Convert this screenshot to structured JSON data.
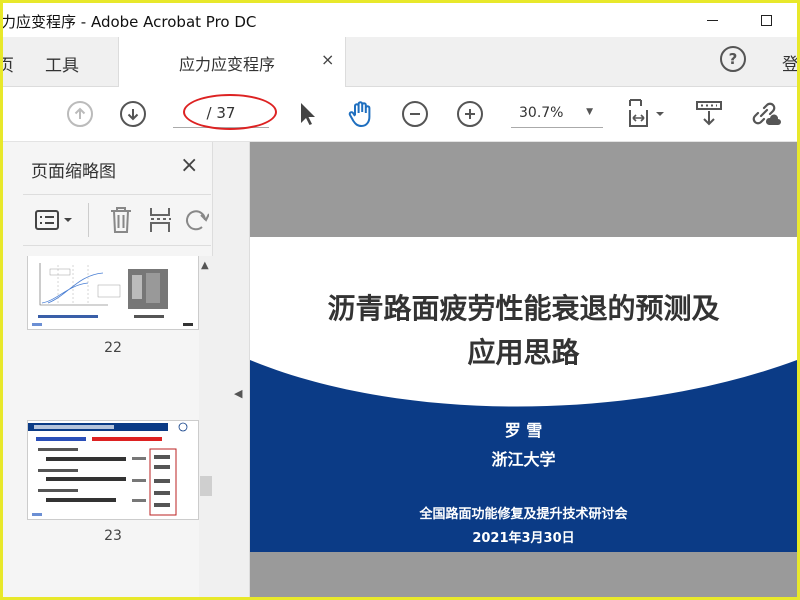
{
  "window": {
    "title": "力应变程序 - Adobe Acrobat Pro DC"
  },
  "tabs": {
    "home_partial": "页",
    "tools": "工具",
    "document": "应力应变程序",
    "close_symbol": "×",
    "help_symbol": "?",
    "login_partial": "登"
  },
  "toolbar": {
    "page_indicator": "/ 37",
    "zoom": "30.7%"
  },
  "left_panel": {
    "title": "页面缩略图",
    "close_symbol": "×",
    "thumbnails": [
      {
        "page": "22"
      },
      {
        "page": "23"
      }
    ]
  },
  "slide": {
    "title_line1": "沥青路面疲劳性能衰退的预测及",
    "title_line2": "应用思路",
    "author": "罗 雪",
    "organization": "浙江大学",
    "meeting": "全国路面功能修复及提升技术研讨会",
    "date": "2021年3月30日"
  },
  "colors": {
    "slide_blue": "#0b3b86",
    "annotation_red": "#dd2222",
    "hand_tool_blue": "#1f6fbf"
  },
  "icons": [
    "previous-page-icon",
    "next-page-icon",
    "select-arrow-icon",
    "hand-tool-icon",
    "zoom-out-icon",
    "zoom-in-icon",
    "page-fit-icon",
    "scroll-mode-icon",
    "share-link-icon"
  ]
}
